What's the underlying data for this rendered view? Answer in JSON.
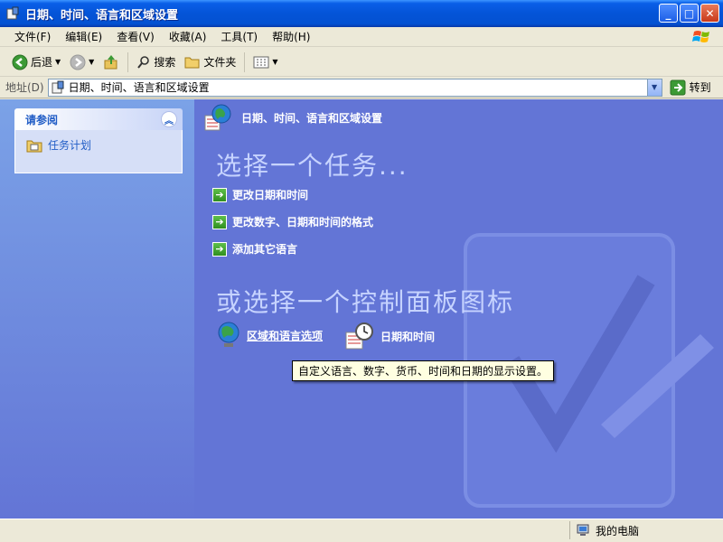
{
  "window": {
    "title": "日期、时间、语言和区域设置"
  },
  "menu": [
    "文件(F)",
    "编辑(E)",
    "查看(V)",
    "收藏(A)",
    "工具(T)",
    "帮助(H)"
  ],
  "toolbar": {
    "back": "后退",
    "search": "搜索",
    "folders": "文件夹"
  },
  "address": {
    "label": "地址(D)",
    "value": "日期、时间、语言和区域设置",
    "go": "转到"
  },
  "left_panel": {
    "title": "请参阅",
    "links": [
      "任务计划"
    ]
  },
  "main": {
    "header": "日期、时间、语言和区域设置",
    "pick_task": "选择一个任务...",
    "tasks": [
      "更改日期和时间",
      "更改数字、日期和时间的格式",
      "添加其它语言"
    ],
    "or_pick_icon": "或选择一个控制面板图标",
    "icons": [
      "区域和语言选项",
      "日期和时间"
    ],
    "tooltip": "自定义语言、数字、货币、时间和日期的显示设置。"
  },
  "status": {
    "computer": "我的电脑"
  },
  "colors": {
    "title_bar": "#0454d7",
    "task_pane": "#6375d6",
    "link": "#215dc6"
  }
}
